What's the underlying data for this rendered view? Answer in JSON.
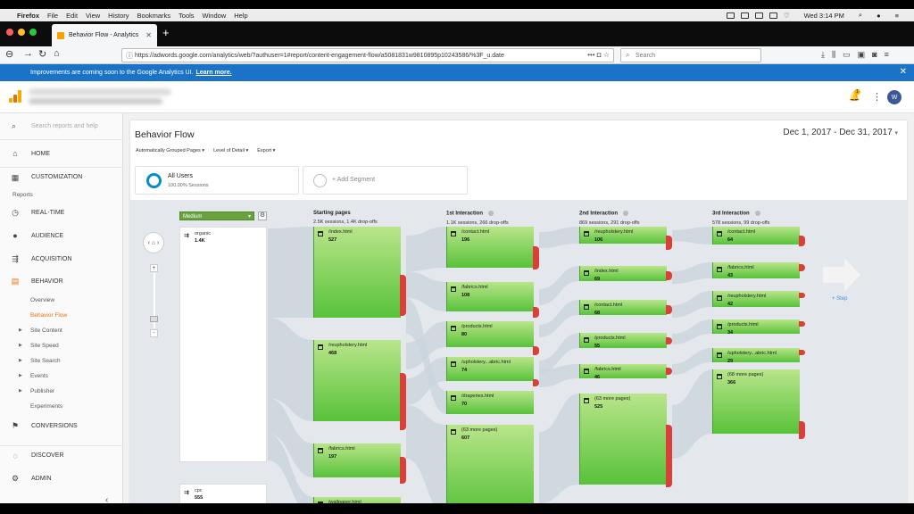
{
  "menubar": {
    "apple": "",
    "app_name": "Firefox",
    "menus": [
      "File",
      "Edit",
      "View",
      "History",
      "Bookmarks",
      "Tools",
      "Window",
      "Help"
    ],
    "clock": "Wed 3:14 PM"
  },
  "browser": {
    "tab_title": "Behavior Flow - Analytics",
    "url": "https://adwords.google.com/analytics/web/?authuser=1#report/content-engagement-flow/a5081831w9810895p10243586/%3F_u.date",
    "search_placeholder": "Search"
  },
  "notice": {
    "text": "Improvements are coming soon to the Google Analytics UI.",
    "link": "Learn more."
  },
  "header": {
    "notification_count": "1",
    "logo_colors": [
      "#f9ab00",
      "#e37400",
      "#f9ab00"
    ]
  },
  "sidebar": {
    "search_placeholder": "Search reports and help",
    "home": "HOME",
    "customization": "CUSTOMIZATION",
    "reports_label": "Reports",
    "realtime": "REAL-TIME",
    "audience": "AUDIENCE",
    "acquisition": "ACQUISITION",
    "behavior": "BEHAVIOR",
    "behavior_items": [
      {
        "label": "Overview",
        "expandable": false
      },
      {
        "label": "Behavior Flow",
        "expandable": false,
        "active": true
      },
      {
        "label": "Site Content",
        "expandable": true
      },
      {
        "label": "Site Speed",
        "expandable": true
      },
      {
        "label": "Site Search",
        "expandable": true
      },
      {
        "label": "Events",
        "expandable": true
      },
      {
        "label": "Publisher",
        "expandable": true
      },
      {
        "label": "Experiments",
        "expandable": false
      }
    ],
    "conversions": "CONVERSIONS",
    "discover": "DISCOVER",
    "admin": "ADMIN",
    "collapse": "‹"
  },
  "report": {
    "title": "Behavior Flow",
    "date_range": "Dec 1, 2017 - Dec 31, 2017",
    "toolbar": [
      "Automatically Grouped Pages",
      "Level of Detail",
      "Export"
    ],
    "segment": {
      "name": "All Users",
      "sub": "100.00% Sessions"
    },
    "add_segment": "+ Add Segment",
    "dimension": "Medium",
    "add_step": "+ Step",
    "accent_color": "#058dc7",
    "node_color": "#5fc43d",
    "dropoff_color": "#d9403a"
  },
  "flow": {
    "sources": [
      {
        "name": "organic",
        "value": "1.4K"
      },
      {
        "name": "cpc",
        "value": "555"
      }
    ],
    "columns": [
      {
        "title": "Starting pages",
        "sub": "2.5K sessions, 1.4K drop-offs",
        "info": false,
        "nodes": [
          {
            "name": "/index.html",
            "value": "527"
          },
          {
            "name": "/reupholstery.html",
            "value": "468"
          },
          {
            "name": "/fabrics.html",
            "value": "197"
          },
          {
            "name": "/wallpaper.html",
            "value": ""
          }
        ]
      },
      {
        "title": "1st Interaction",
        "sub": "1.1K sessions, 266 drop-offs",
        "info": true,
        "nodes": [
          {
            "name": "/contact.html",
            "value": "196"
          },
          {
            "name": "/fabrics.html",
            "value": "108"
          },
          {
            "name": "/products.html",
            "value": "80"
          },
          {
            "name": "/upholstery...abric.html",
            "value": "74"
          },
          {
            "name": "/draperies.html",
            "value": "70"
          },
          {
            "name": "(63 more pages)",
            "value": "607"
          }
        ]
      },
      {
        "title": "2nd Interaction",
        "sub": "869 sessions, 291 drop-offs",
        "info": true,
        "nodes": [
          {
            "name": "/reupholstery.html",
            "value": "106"
          },
          {
            "name": "/index.html",
            "value": "69"
          },
          {
            "name": "/contact.html",
            "value": "68"
          },
          {
            "name": "/products.html",
            "value": "55"
          },
          {
            "name": "/fabrics.html",
            "value": "46"
          },
          {
            "name": "(63 more pages)",
            "value": "525"
          }
        ]
      },
      {
        "title": "3rd Interaction",
        "sub": "578 sessions, 99 drop-offs",
        "info": true,
        "nodes": [
          {
            "name": "/contact.html",
            "value": "64"
          },
          {
            "name": "/fabrics.html",
            "value": "43"
          },
          {
            "name": "/reupholstery.html",
            "value": "42"
          },
          {
            "name": "/products.html",
            "value": "34"
          },
          {
            "name": "/upholstery...abric.html",
            "value": "29"
          },
          {
            "name": "(68 more pages)",
            "value": "366"
          }
        ]
      }
    ]
  }
}
